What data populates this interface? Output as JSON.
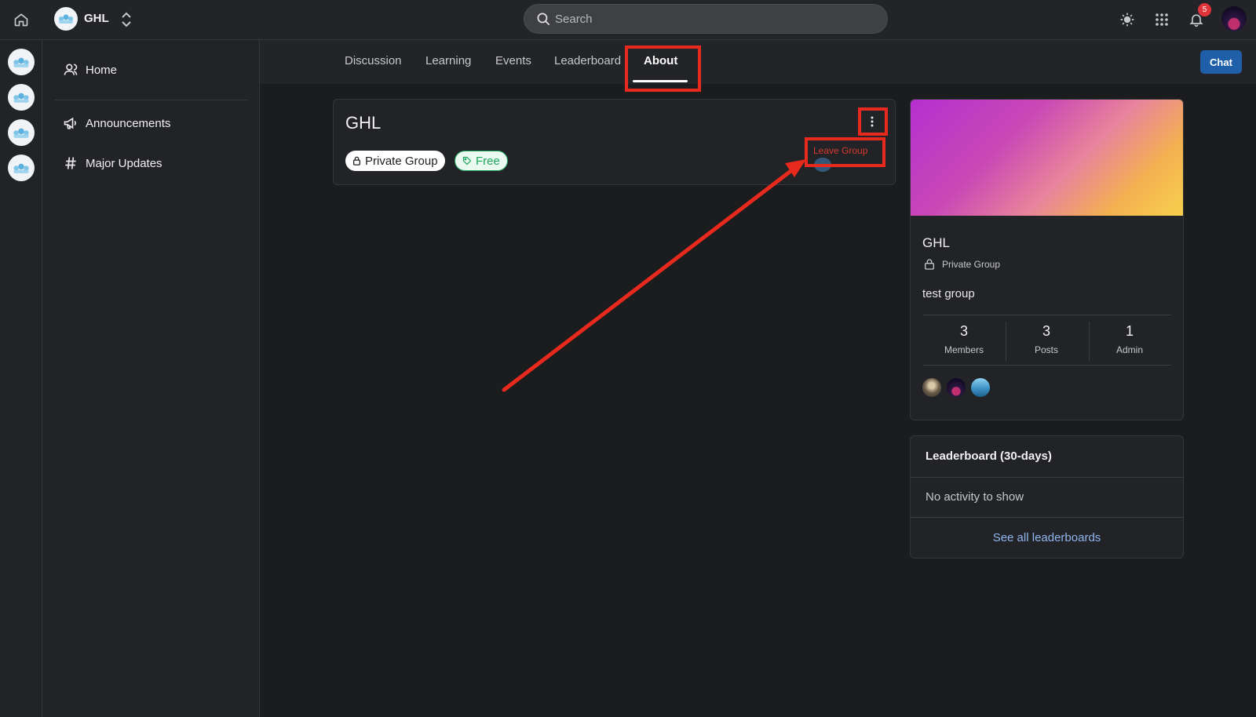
{
  "topbar": {
    "group_name": "GHL",
    "search_placeholder": "Search",
    "notification_count": "5",
    "icons": [
      "home-icon",
      "chevron-updown-icon",
      "search-icon",
      "sun-icon",
      "apps-grid-icon",
      "bell-icon"
    ]
  },
  "rail": {
    "groups": [
      "group-1",
      "group-2",
      "group-3",
      "group-4"
    ]
  },
  "sidebar": {
    "items": [
      {
        "label": "Home",
        "icon": "user-icon"
      },
      {
        "label": "Announcements",
        "icon": "megaphone-icon"
      },
      {
        "label": "Major Updates",
        "icon": "hash-icon"
      }
    ]
  },
  "tabs": {
    "items": [
      "Discussion",
      "Learning",
      "Events",
      "Leaderboard",
      "About"
    ],
    "active": "About",
    "chat_label": "Chat"
  },
  "main_card": {
    "title": "GHL",
    "privacy_chip": "Private Group",
    "price_chip": "Free",
    "menu_action": "Leave Group"
  },
  "group_card": {
    "name": "GHL",
    "privacy": "Private Group",
    "description": "test group",
    "stats": [
      {
        "value": "3",
        "label": "Members"
      },
      {
        "value": "3",
        "label": "Posts"
      },
      {
        "value": "1",
        "label": "Admin"
      }
    ]
  },
  "leaderboard": {
    "title": "Leaderboard (30-days)",
    "empty_text": "No activity to show",
    "link": "See all leaderboards"
  },
  "colors": {
    "accent_button": "#1f5ea8",
    "annotation_red": "#e8291d",
    "free_green": "#1ea45e",
    "link_blue": "#8fb5ee"
  }
}
